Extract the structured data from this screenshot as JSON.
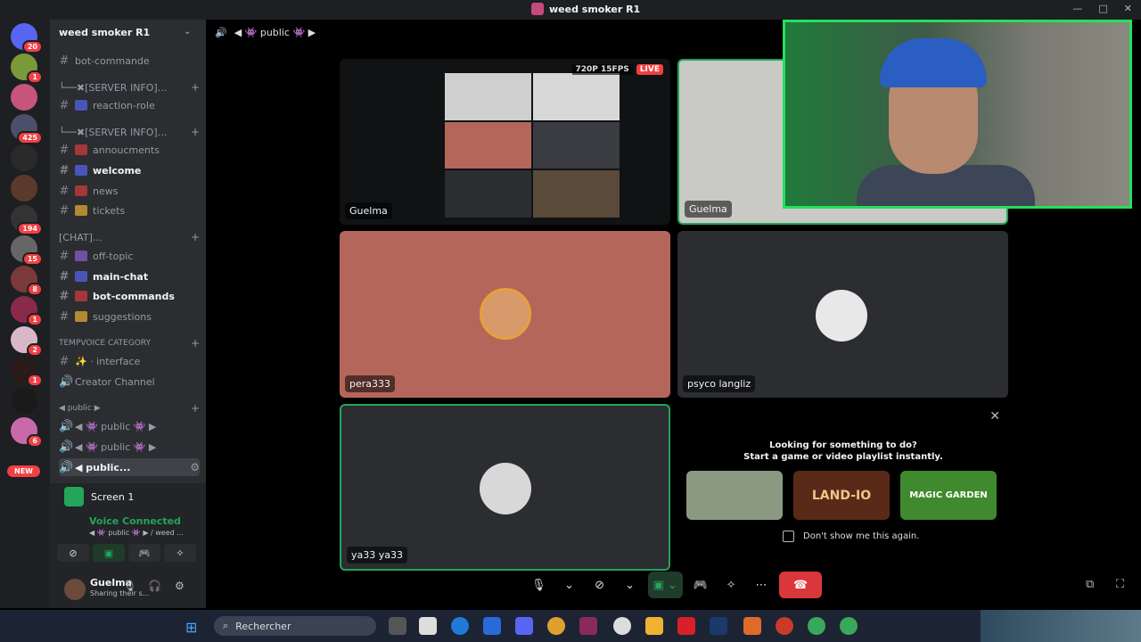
{
  "window": {
    "title": "weed smoker R1",
    "controls": [
      "—",
      "□",
      "✕"
    ]
  },
  "servers": [
    {
      "badge": "20"
    },
    {
      "badge": "1"
    },
    {
      "badge": ""
    },
    {
      "badge": "425"
    },
    {
      "badge": ""
    },
    {
      "badge": ""
    },
    {
      "badge": "194"
    },
    {
      "badge": "15"
    },
    {
      "badge": "8"
    },
    {
      "badge": "1"
    },
    {
      "badge": "2"
    },
    {
      "badge": "1"
    },
    {
      "badge": ""
    },
    {
      "badge": "6"
    }
  ],
  "servers_new_label": "NEW",
  "guild": {
    "name": "weed smoker R1",
    "channels": [
      {
        "label": "bot-commande",
        "bold": false
      },
      {
        "label": "└──✖[SERVER INFO]...",
        "bold": false,
        "plus": "+"
      },
      {
        "label": "reaction-role",
        "bold": false
      },
      {
        "label": "└──✖[SERVER INFO]...",
        "bold": false,
        "plus": "+"
      },
      {
        "label": "annoucments",
        "bold": false
      },
      {
        "label": "welcome",
        "bold": true
      },
      {
        "label": "news",
        "bold": false
      },
      {
        "label": "tickets",
        "bold": false
      },
      {
        "label": "[CHAT]...",
        "bold": false,
        "plus": "+"
      },
      {
        "label": "off-topic",
        "bold": false
      },
      {
        "label": "main-chat",
        "bold": true
      },
      {
        "label": "bot-commands",
        "bold": true
      },
      {
        "label": "suggestions",
        "bold": false
      }
    ],
    "category": "TEMPVOICE CATEGORY",
    "category_plus": "+",
    "tempvoice": [
      {
        "label": "✨ · interface"
      },
      {
        "label": "Creator Channel"
      }
    ],
    "public_category": "◀ public ▶",
    "voice_channels": [
      {
        "label": "◀ 👾 public 👾 ▶"
      },
      {
        "label": "◀ 👾 public 👾 ▶"
      },
      {
        "label": "◀ public..."
      }
    ]
  },
  "voice_panel": {
    "screen_label": "Screen 1",
    "status": "Voice Connected",
    "channel": "◀ 👾 public 👾 ▶ / weed ...",
    "user_name": "Guelma",
    "user_status": "Sharing their s..."
  },
  "stage": {
    "header": "◀ 👾 public 👾 ▶",
    "tiles": [
      {
        "name": "Guelma",
        "quality": "720P 15FPS",
        "live": "LIVE"
      },
      {
        "name": "Guelma"
      },
      {
        "name": "pera333"
      },
      {
        "name": "psyco langliz"
      },
      {
        "name": "ya33 ya33"
      }
    ]
  },
  "activity": {
    "title_line1": "Looking for something to do?",
    "title_line2": "Start a game or video playlist instantly.",
    "games": [
      {
        "label": "",
        "color": "#7a8a70"
      },
      {
        "label": "LAND-IO",
        "color": "#5a2a18"
      },
      {
        "label": "MAGIC GARDEN",
        "color": "#3f8a2e"
      }
    ],
    "dont_show": "Don't show me this again."
  },
  "taskbar": {
    "search_placeholder": "Rechercher"
  },
  "colors": {
    "accent_green": "#23a55a",
    "hangup": "#da373c",
    "tile_salmon": "#b5665a"
  }
}
